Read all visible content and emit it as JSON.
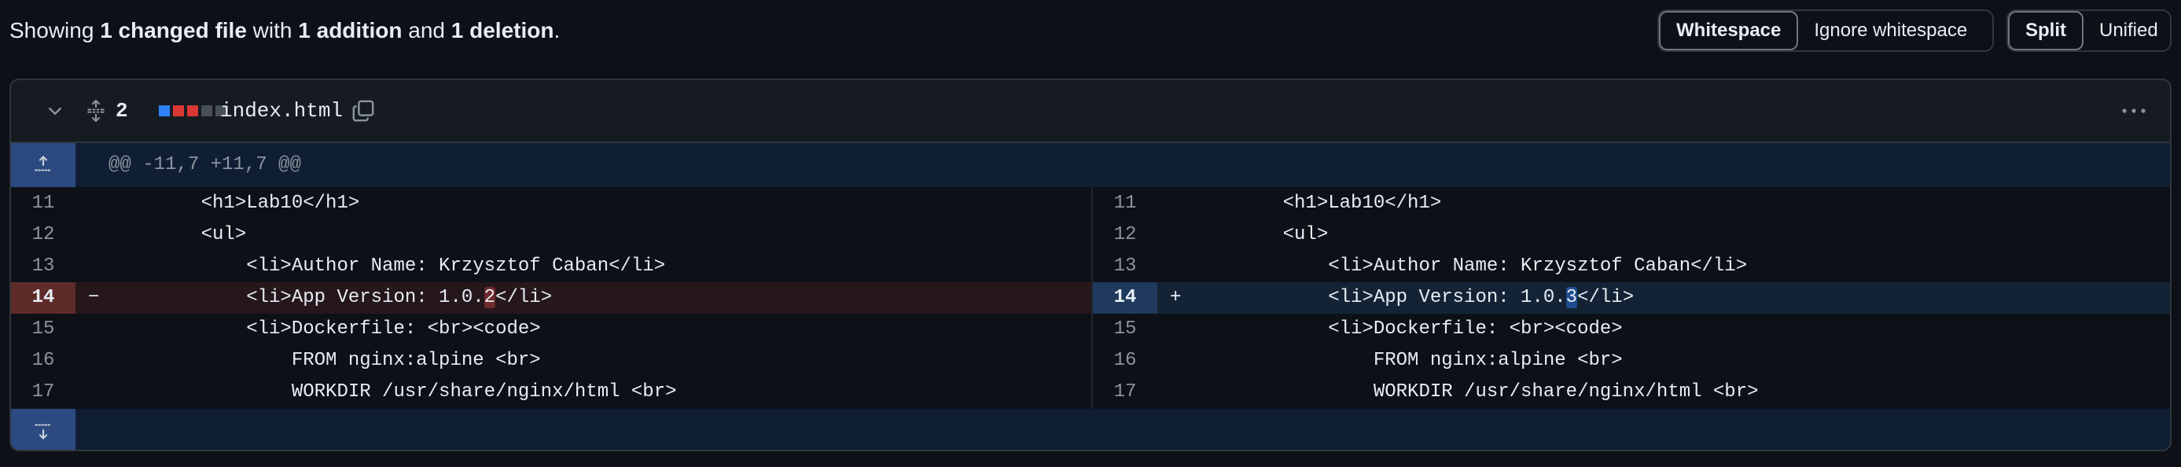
{
  "summary": {
    "prefix": "Showing ",
    "files": "1 changed file",
    "mid1": " with ",
    "additions": "1 addition",
    "mid2": " and ",
    "deletions": "1 deletion",
    "suffix": "."
  },
  "whitespace_toggle": {
    "active": "Whitespace",
    "inactive": "Ignore whitespace"
  },
  "view_toggle": {
    "active": "Split",
    "inactive": "Unified"
  },
  "file": {
    "change_count": "2",
    "name": "index.html",
    "diffstat_colors": [
      "#2f81f7",
      "#da3633",
      "#da3633",
      "#484f58",
      "#484f58",
      "#484f58"
    ],
    "hunk_header": "@@ -11,7 +11,7 @@"
  },
  "left_lines": [
    {
      "num": "11",
      "sign": "",
      "code": "    <h1>Lab10</h1>",
      "type": "context"
    },
    {
      "num": "12",
      "sign": "",
      "code": "    <ul>",
      "type": "context"
    },
    {
      "num": "13",
      "sign": "",
      "code": "        <li>Author Name: Krzysztof Caban</li>",
      "type": "context"
    },
    {
      "num": "14",
      "sign": "−",
      "code_pre": "        <li>App Version: 1.0.",
      "code_hl": "2",
      "code_post": "</li>",
      "type": "del"
    },
    {
      "num": "15",
      "sign": "",
      "code": "        <li>Dockerfile: <br><code>",
      "type": "context"
    },
    {
      "num": "16",
      "sign": "",
      "code": "            FROM nginx:alpine <br>",
      "type": "context"
    },
    {
      "num": "17",
      "sign": "",
      "code": "            WORKDIR /usr/share/nginx/html <br>",
      "type": "context"
    }
  ],
  "right_lines": [
    {
      "num": "11",
      "sign": "",
      "code": "    <h1>Lab10</h1>",
      "type": "context"
    },
    {
      "num": "12",
      "sign": "",
      "code": "    <ul>",
      "type": "context"
    },
    {
      "num": "13",
      "sign": "",
      "code": "        <li>Author Name: Krzysztof Caban</li>",
      "type": "context"
    },
    {
      "num": "14",
      "sign": "+",
      "code_pre": "        <li>App Version: 1.0.",
      "code_hl": "3",
      "code_post": "</li>",
      "type": "add"
    },
    {
      "num": "15",
      "sign": "",
      "code": "        <li>Dockerfile: <br><code>",
      "type": "context"
    },
    {
      "num": "16",
      "sign": "",
      "code": "            FROM nginx:alpine <br>",
      "type": "context"
    },
    {
      "num": "17",
      "sign": "",
      "code": "            WORKDIR /usr/share/nginx/html <br>",
      "type": "context"
    }
  ],
  "icons": {
    "collapse": "chevron-down-icon",
    "expand_all": "unfold-icon",
    "copy": "copy-icon",
    "more": "kebab-horizontal-icon",
    "expand_up": "fold-up-icon",
    "expand_down": "fold-down-icon"
  }
}
